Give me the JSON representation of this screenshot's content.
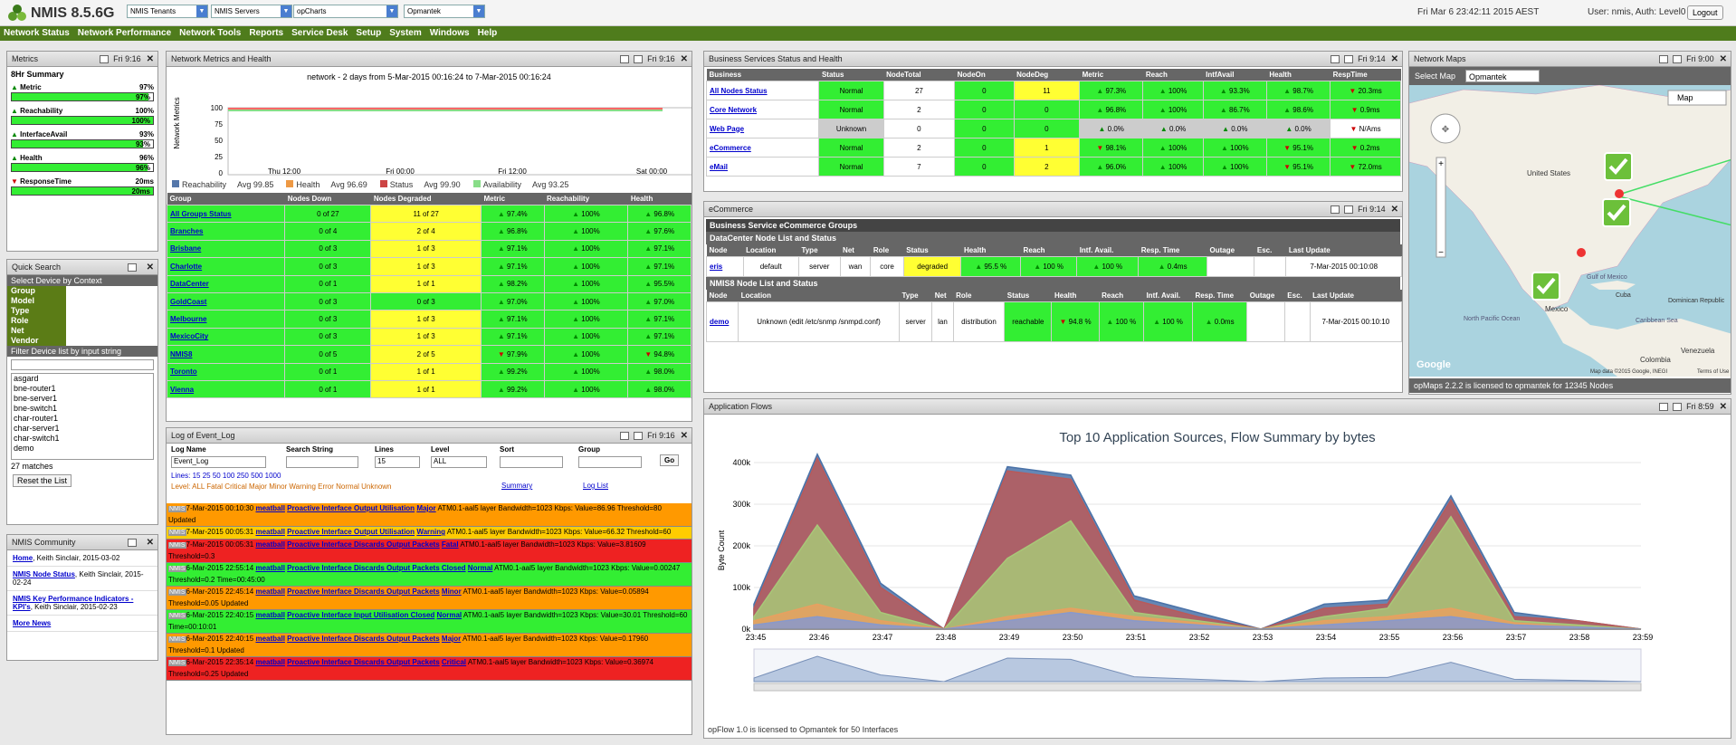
{
  "app": {
    "title": "NMIS 8.5.6G",
    "tenant": "NMIS Tenants",
    "servers": "NMIS Servers",
    "module": "opCharts",
    "company": "Opmantek",
    "clock": "Fri Mar 6 23:42:11 2015 AEST",
    "user": "User: nmis, Auth: Level0",
    "logout": "Logout"
  },
  "menu": [
    "Network Status",
    "Network Performance",
    "Network Tools",
    "Reports",
    "Service Desk",
    "Setup",
    "System",
    "Windows",
    "Help"
  ],
  "metrics": {
    "title": "Metrics",
    "time": "Fri 9:16",
    "summary": "8Hr Summary",
    "items": [
      {
        "name": "Metric",
        "value": "97%",
        "fill": 97,
        "arrow": "up"
      },
      {
        "name": "Reachability",
        "value": "100%",
        "fill": 100,
        "arrow": "up"
      },
      {
        "name": "InterfaceAvail",
        "value": "93%",
        "fill": 93,
        "arrow": "up"
      },
      {
        "name": "Health",
        "value": "96%",
        "fill": 96,
        "arrow": "up"
      },
      {
        "name": "ResponseTime",
        "value": "20ms",
        "fill": 100,
        "arrow": "down"
      }
    ]
  },
  "quicksearch": {
    "title": "Quick Search",
    "ctx_label": "Select Device by Context",
    "contexts": [
      "Group",
      "Model",
      "Type",
      "Role",
      "Net",
      "Vendor"
    ],
    "filter_label": "Filter Device list by input string",
    "devices": [
      "asgard",
      "bne-router1",
      "bne-server1",
      "bne-switch1",
      "char-router1",
      "char-server1",
      "char-switch1",
      "demo"
    ],
    "matches": "27 matches",
    "reset": "Reset the List"
  },
  "community": {
    "title": "NMIS Community",
    "items": [
      {
        "link": "Home",
        "text": ", Keith Sinclair, 2015-03-02"
      },
      {
        "link": "NMIS Node Status",
        "text": ", Keith Sinclair, 2015-02-24"
      },
      {
        "link": "NMIS Key Performance Indicators - KPI's",
        "text": ", Keith Sinclair, 2015-02-23"
      },
      {
        "link": "More News",
        "text": ""
      }
    ]
  },
  "netmetrics": {
    "title": "Network Metrics and Health",
    "time": "Fri 9:16",
    "chart_title": "network - 2 days from 5-Mar-2015 00:16:24 to 7-Mar-2015 00:16:24",
    "ylabel": "Network Metrics",
    "yticks": [
      "100",
      "75",
      "50",
      "25",
      "0"
    ],
    "xticks": [
      "Thu 12:00",
      "Fri 00:00",
      "Fri 12:00",
      "Sat 00:00"
    ],
    "legend": [
      {
        "name": "Reachability",
        "avg": "Avg 99.85",
        "color": "#5577aa"
      },
      {
        "name": "Health",
        "avg": "Avg 96.69",
        "color": "#ee9944"
      },
      {
        "name": "Status",
        "avg": "Avg 99.90",
        "color": "#cc4444"
      },
      {
        "name": "Availability",
        "avg": "Avg 93.25",
        "color": "#88dd88"
      }
    ],
    "headers": [
      "Group",
      "Nodes Down",
      "Nodes Degraded",
      "Metric",
      "Reachability",
      "Health"
    ],
    "rows": [
      [
        "All Groups Status",
        "0 of 27",
        "11 of 27",
        "97.4%",
        "100%",
        "96.8%"
      ],
      [
        "Branches",
        "0 of 4",
        "2 of 4",
        "96.8%",
        "100%",
        "97.6%"
      ],
      [
        "Brisbane",
        "0 of 3",
        "1 of 3",
        "97.1%",
        "100%",
        "97.1%"
      ],
      [
        "Charlotte",
        "0 of 3",
        "1 of 3",
        "97.1%",
        "100%",
        "97.1%"
      ],
      [
        "DataCenter",
        "0 of 1",
        "1 of 1",
        "98.2%",
        "100%",
        "95.5%"
      ],
      [
        "GoldCoast",
        "0 of 3",
        "0 of 3",
        "97.0%",
        "100%",
        "97.0%"
      ],
      [
        "Melbourne",
        "0 of 3",
        "1 of 3",
        "97.1%",
        "100%",
        "97.1%"
      ],
      [
        "MexicoCity",
        "0 of 3",
        "1 of 3",
        "97.1%",
        "100%",
        "97.1%"
      ],
      [
        "NMIS8",
        "0 of 5",
        "2 of 5",
        "97.9%",
        "100%",
        "94.8%"
      ],
      [
        "Toronto",
        "0 of 1",
        "1 of 1",
        "99.2%",
        "100%",
        "98.0%"
      ],
      [
        "Vienna",
        "0 of 1",
        "1 of 1",
        "99.2%",
        "100%",
        "98.0%"
      ]
    ]
  },
  "eventlog": {
    "title": "Log of Event_Log",
    "time": "Fri 9:16",
    "labels": [
      "Log Name",
      "Search String",
      "Lines",
      "Level",
      "Sort",
      "Group"
    ],
    "logname": "Event_Log",
    "lines": "15",
    "level": "ALL",
    "go": "Go",
    "lines_opts": "Lines:  15 25 50 100 250 500 1000",
    "level_opts": "Level:  ALL  Fatal  Critical  Major  Minor  Warning  Error  Normal  Unknown",
    "summary": "Summary",
    "loglist": "Log List",
    "events": [
      {
        "cls": "ro",
        "date": "7-Mar-2015 00:10:30",
        "node": "meatball",
        "event": "Proactive Interface Output Utilisation",
        "lvl": "Major",
        "text": "ATM0.1-aal5 layer Bandwidth=1023 Kbps: Value=86.96 Threshold=80 Updated"
      },
      {
        "cls": "ry",
        "date": "7-Mar-2015 00:05:31",
        "node": "meatball",
        "event": "Proactive Interface Output Utilisation",
        "lvl": "Warning",
        "text": "ATM0.1-aal5 layer Bandwidth=1023 Kbps: Value=66.32 Threshold=60"
      },
      {
        "cls": "rr",
        "date": "7-Mar-2015 00:05:31",
        "node": "meatball",
        "event": "Proactive Interface Discards Output Packets",
        "lvl": "Fatal",
        "text": "ATM0.1-aal5 layer Bandwidth=1023 Kbps: Value=3.81609 Threshold=0.3"
      },
      {
        "cls": "rg",
        "date": "6-Mar-2015 22:55:14",
        "node": "meatball",
        "event": "Proactive Interface Discards Output Packets Closed",
        "lvl": "Normal",
        "text": "ATM0.1-aal5 layer Bandwidth=1023 Kbps: Value=0.00247 Threshold=0.2 Time=00:45:00"
      },
      {
        "cls": "ro",
        "date": "6-Mar-2015 22:45:14",
        "node": "meatball",
        "event": "Proactive Interface Discards Output Packets",
        "lvl": "Minor",
        "text": "ATM0.1-aal5 layer Bandwidth=1023 Kbps: Value=0.05894 Threshold=0.05 Updated"
      },
      {
        "cls": "rg",
        "date": "6-Mar-2015 22:40:15",
        "node": "meatball",
        "event": "Proactive Interface Input Utilisation Closed",
        "lvl": "Normal",
        "text": "ATM0.1-aal5 layer Bandwidth=1023 Kbps: Value=30.01 Threshold=60 Time=00:10:01"
      },
      {
        "cls": "ro",
        "date": "6-Mar-2015 22:40:15",
        "node": "meatball",
        "event": "Proactive Interface Discards Output Packets",
        "lvl": "Major",
        "text": "ATM0.1-aal5 layer Bandwidth=1023 Kbps: Value=0.17960 Threshold=0.1 Updated"
      },
      {
        "cls": "rr",
        "date": "6-Mar-2015 22:35:14",
        "node": "meatball",
        "event": "Proactive Interface Discards Output Packets",
        "lvl": "Critical",
        "text": "ATM0.1-aal5 layer Bandwidth=1023 Kbps: Value=0.36974 Threshold=0.25 Updated"
      }
    ]
  },
  "bizsvc": {
    "title": "Business Services Status and Health",
    "time": "Fri 9:14",
    "headers": [
      "Business",
      "Status",
      "NodeTotal",
      "NodeOn",
      "NodeDeg",
      "Metric",
      "Reach",
      "IntfAvail",
      "Health",
      "RespTime"
    ],
    "rows": [
      {
        "c": [
          "All Nodes Status",
          "Normal",
          "27",
          "0",
          "11",
          "97.3%",
          "100%",
          "93.3%",
          "98.7%",
          "20.3ms"
        ],
        "cls": [
          "w",
          "g",
          "w",
          "g",
          "y",
          "g",
          "g",
          "g",
          "g",
          "g"
        ]
      },
      {
        "c": [
          "Core Network",
          "Normal",
          "2",
          "0",
          "0",
          "96.8%",
          "100%",
          "86.7%",
          "98.6%",
          "0.9ms"
        ],
        "cls": [
          "w",
          "g",
          "w",
          "g",
          "g",
          "g",
          "g",
          "g",
          "g",
          "g"
        ]
      },
      {
        "c": [
          "Web Page",
          "Unknown",
          "0",
          "0",
          "0",
          "0.0%",
          "0.0%",
          "0.0%",
          "0.0%",
          "N/Ams"
        ],
        "cls": [
          "w",
          "gr",
          "w",
          "g",
          "g",
          "gr",
          "gr",
          "gr",
          "gr",
          "w"
        ]
      },
      {
        "c": [
          "eCommerce",
          "Normal",
          "2",
          "0",
          "1",
          "98.1%",
          "100%",
          "100%",
          "95.1%",
          "0.2ms"
        ],
        "cls": [
          "w",
          "g",
          "w",
          "g",
          "y",
          "g",
          "g",
          "g",
          "g",
          "g"
        ]
      },
      {
        "c": [
          "eMail",
          "Normal",
          "7",
          "0",
          "2",
          "96.0%",
          "100%",
          "100%",
          "95.1%",
          "72.0ms"
        ],
        "cls": [
          "w",
          "g",
          "w",
          "g",
          "y",
          "g",
          "g",
          "g",
          "g",
          "g"
        ]
      }
    ]
  },
  "ecommerce": {
    "title": "eCommerce",
    "time": "Fri 9:14",
    "group_title": "Business Service eCommerce Groups",
    "sec1": "DataCenter Node List and Status",
    "sec2": "NMIS8 Node List and Status",
    "headers": [
      "Node",
      "Location",
      "Type",
      "Net",
      "Role",
      "Status",
      "Health",
      "Reach",
      "Intf. Avail.",
      "Resp. Time",
      "Outage",
      "Esc.",
      "Last Update"
    ],
    "row1": [
      "eris",
      "default",
      "server",
      "wan",
      "core",
      "degraded",
      "95.5 %",
      "100 %",
      "100 %",
      "0.4ms",
      "",
      "",
      "7-Mar-2015 00:10:08"
    ],
    "row2": [
      "demo",
      "Unknown (edit /etc/snmp /snmpd.conf)",
      "server",
      "lan",
      "distribution",
      "reachable",
      "94.8 %",
      "100 %",
      "100 %",
      "0.0ms",
      "",
      "",
      "7-Mar-2015 00:10:10"
    ]
  },
  "netmaps": {
    "title": "Network Maps",
    "time": "Fri 9:00",
    "select_label": "Select Map",
    "select_value": "Opmantek",
    "maptype": "Map",
    "attribution": "Map data ©2015 Google, INEGI",
    "terms": "Terms of Use",
    "google": "Google",
    "footer": "opMaps 2.2.2 is licensed to opmantek for 12345 Nodes",
    "labels": [
      "Gulf of Mexico",
      "Mexico",
      "Venezuela",
      "Colombia",
      "Cuba",
      "Dominican Republic",
      "United States",
      "North Pacific Ocean",
      "Caribbean Sea"
    ]
  },
  "flows": {
    "title": "Application Flows",
    "time": "Fri 8:59",
    "footer": "opFlow 1.0 is licensed to Opmantek for 50 Interfaces"
  },
  "chart_data": {
    "type": "area",
    "title": "Top 10 Application Sources, Flow Summary by bytes",
    "ylabel": "Byte Count",
    "yticks": [
      "0k",
      "100k",
      "200k",
      "300k",
      "400k"
    ],
    "x": [
      "23:45",
      "23:46",
      "23:47",
      "23:48",
      "23:49",
      "23:50",
      "23:51",
      "23:52",
      "23:53",
      "23:54",
      "23:55",
      "23:56",
      "23:57",
      "23:58",
      "23:59"
    ],
    "ylim": [
      0,
      450000
    ],
    "series": [
      {
        "color": "#4a72a8",
        "values": [
          60000,
          420000,
          110000,
          0,
          390000,
          370000,
          80000,
          40000,
          0,
          60000,
          70000,
          320000,
          40000,
          20000,
          0
        ]
      },
      {
        "color": "#b85a5a",
        "values": [
          50000,
          410000,
          100000,
          0,
          380000,
          360000,
          70000,
          30000,
          0,
          50000,
          60000,
          310000,
          30000,
          20000,
          0
        ]
      },
      {
        "color": "#a8c878",
        "values": [
          30000,
          250000,
          40000,
          0,
          170000,
          260000,
          40000,
          20000,
          0,
          30000,
          50000,
          270000,
          20000,
          10000,
          0
        ]
      },
      {
        "color": "#e8a060",
        "values": [
          20000,
          60000,
          20000,
          0,
          30000,
          50000,
          30000,
          15000,
          0,
          20000,
          30000,
          50000,
          15000,
          5000,
          0
        ]
      },
      {
        "color": "#8899cc",
        "values": [
          10000,
          30000,
          10000,
          0,
          20000,
          40000,
          20000,
          10000,
          0,
          10000,
          20000,
          30000,
          10000,
          5000,
          0
        ]
      }
    ]
  }
}
